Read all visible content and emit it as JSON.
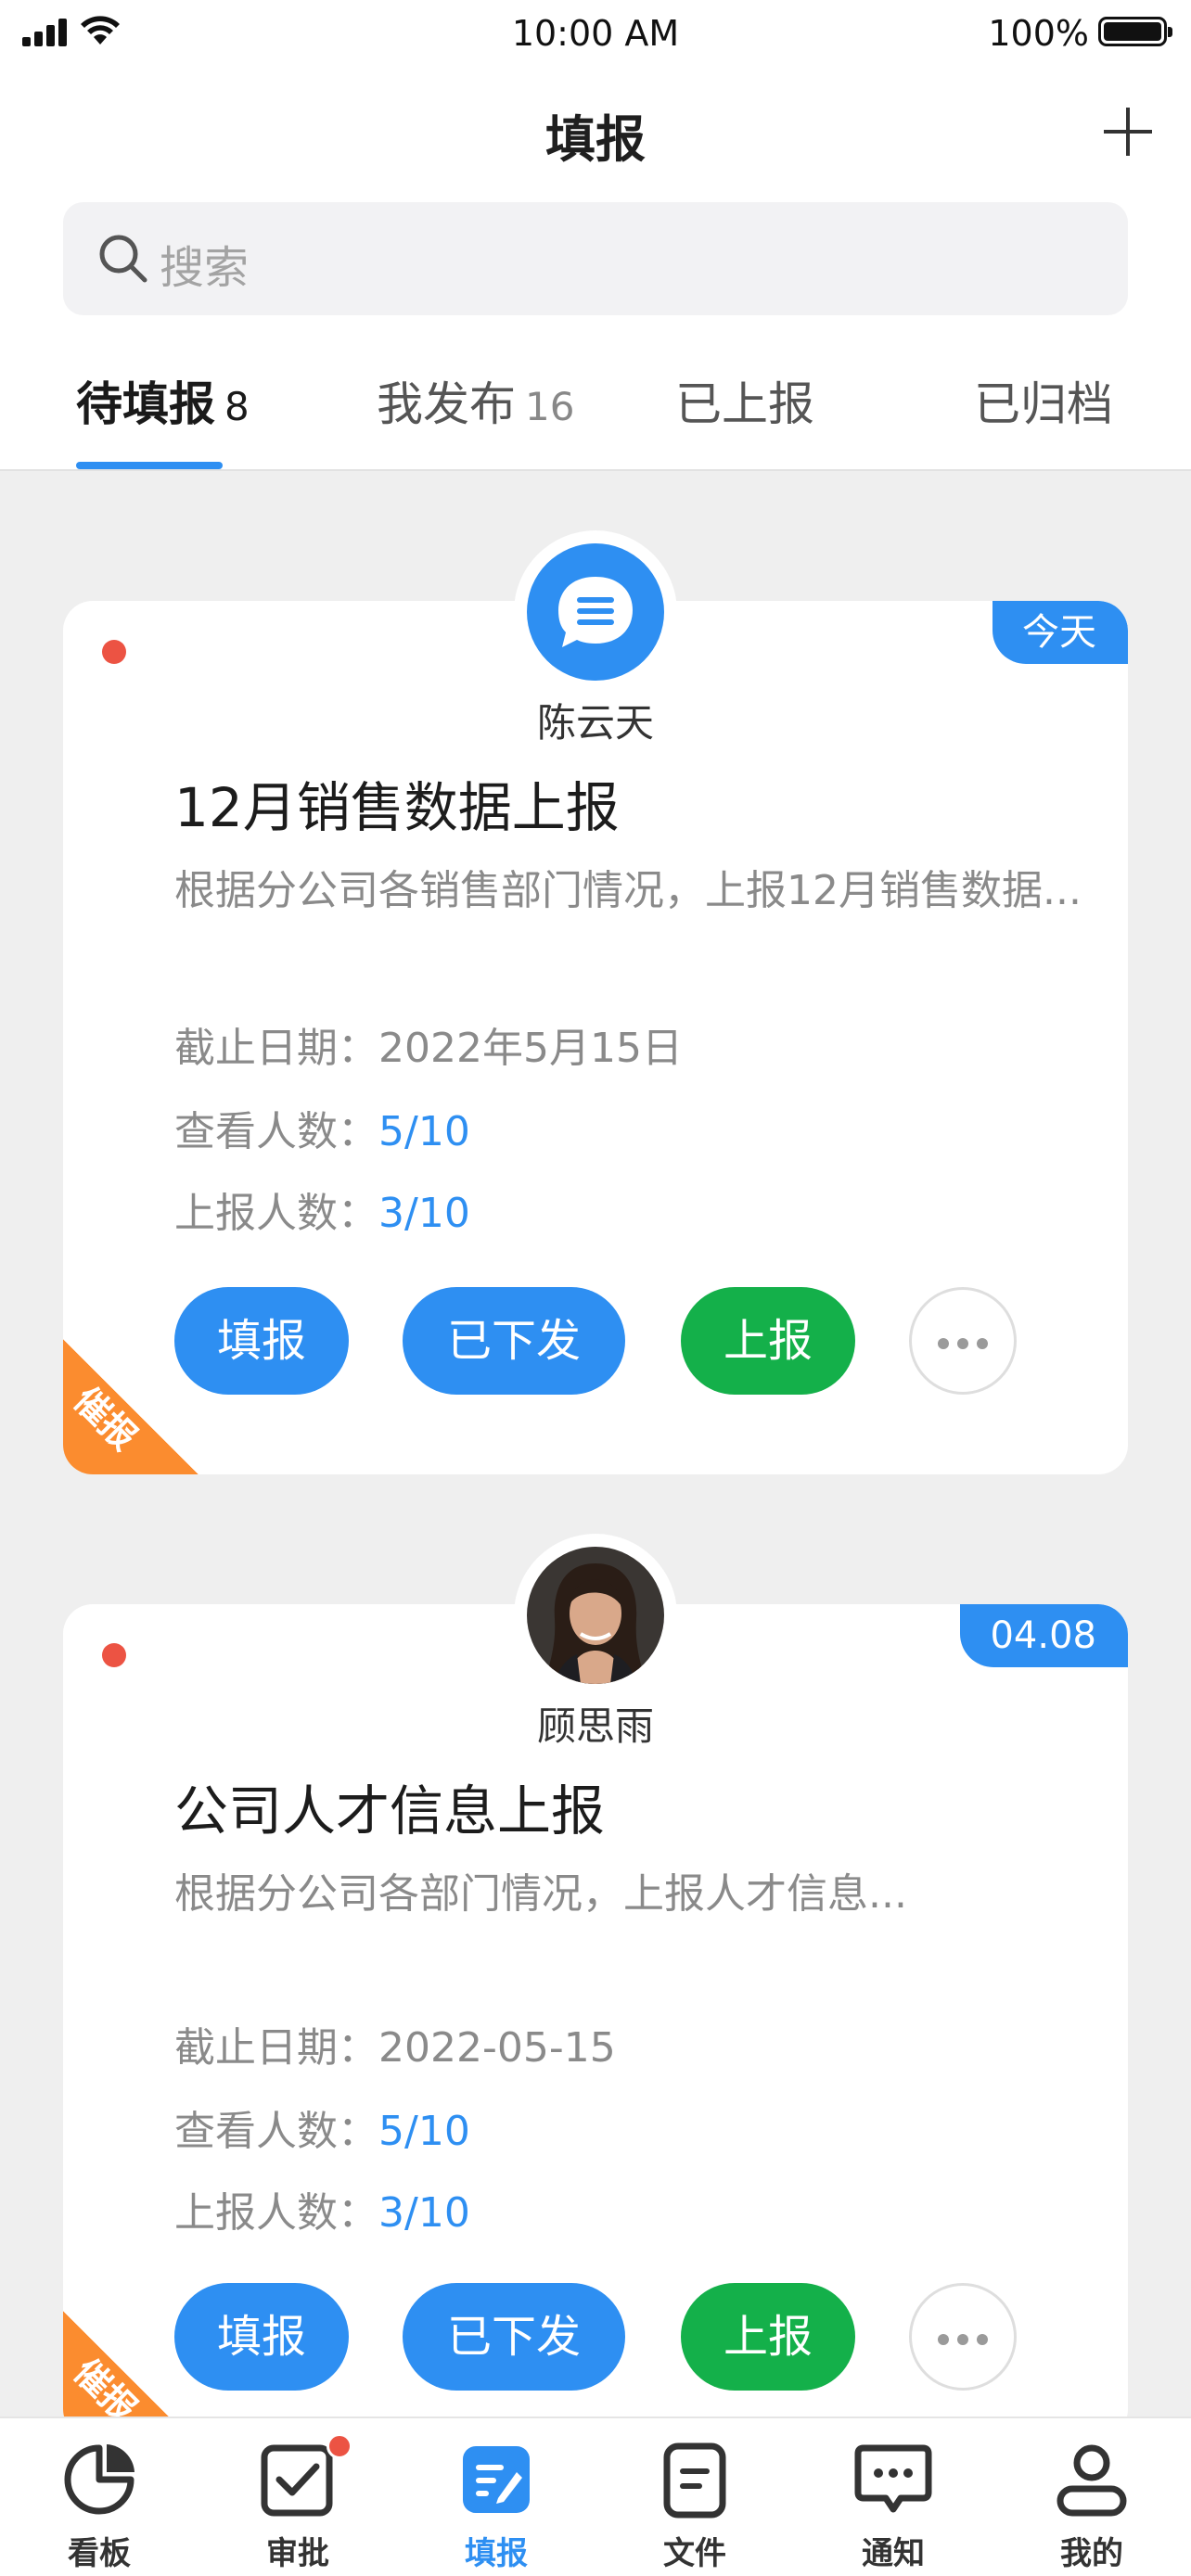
{
  "status": {
    "time": "10:00 AM",
    "battery": "100%"
  },
  "header": {
    "title": "填报",
    "add_icon": "plus-icon"
  },
  "search": {
    "placeholder": "搜索",
    "icon": "search-icon"
  },
  "tabs": [
    {
      "label": "待填报",
      "count": "8",
      "active": true
    },
    {
      "label": "我发布",
      "count": "16",
      "active": false
    },
    {
      "label": "已上报",
      "count": "",
      "active": false
    },
    {
      "label": "已归档",
      "count": "",
      "active": false
    }
  ],
  "cards": [
    {
      "sender": "陈云天",
      "avatar": "chat-bubble-icon",
      "date_badge": "今天",
      "title": "12月销售数据上报",
      "description": "根据分公司各销售部门情况，上报12月销售数据...",
      "deadline_label": "截止日期：",
      "deadline": "2022年5月15日",
      "viewed_label": "查看人数：",
      "viewed": "5/10",
      "reported_label": "上报人数：",
      "reported": "3/10",
      "buttons": {
        "fill": "填报",
        "issued": "已下发",
        "report": "上报"
      },
      "ribbon": "催报"
    },
    {
      "sender": "顾思雨",
      "avatar": "user-photo",
      "date_badge": "04.08",
      "title": "公司人才信息上报",
      "description": "根据分公司各部门情况，上报人才信息...",
      "deadline_label": "截止日期：",
      "deadline": "2022-05-15",
      "viewed_label": "查看人数：",
      "viewed": "5/10",
      "reported_label": "上报人数：",
      "reported": "3/10",
      "buttons": {
        "fill": "填报",
        "issued": "已下发",
        "report": "上报"
      },
      "ribbon": "催报"
    }
  ],
  "tabbar": [
    {
      "label": "看板",
      "icon": "pie-chart-icon",
      "active": false
    },
    {
      "label": "审批",
      "icon": "check-square-icon",
      "active": false,
      "badge": true
    },
    {
      "label": "填报",
      "icon": "edit-document-icon",
      "active": true
    },
    {
      "label": "文件",
      "icon": "file-icon",
      "active": false
    },
    {
      "label": "通知",
      "icon": "message-icon",
      "active": false
    },
    {
      "label": "我的",
      "icon": "user-icon",
      "active": false
    }
  ],
  "colors": {
    "primary": "#2e8ff2",
    "success": "#14b04a",
    "urge": "#fb8c2f",
    "unread": "#ec5343"
  }
}
